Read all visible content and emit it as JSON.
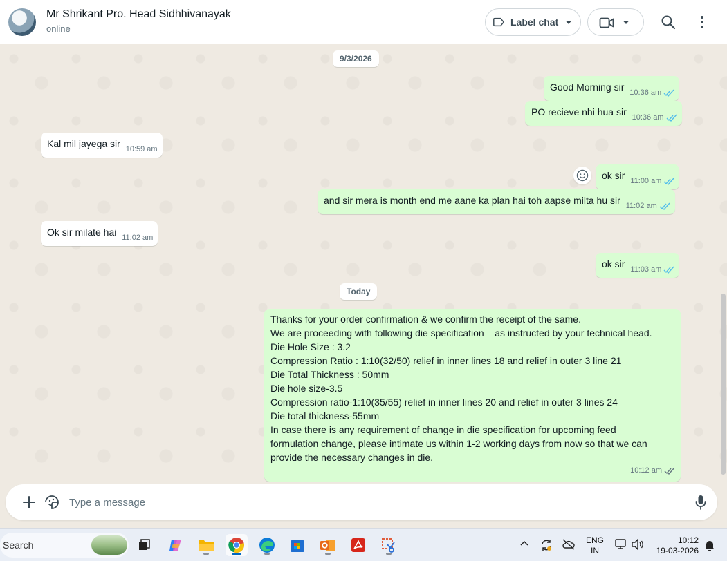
{
  "header": {
    "contact_name": "Mr Shrikant Pro. Head Sidhhivanayak",
    "status": "online",
    "label_chat": "Label chat",
    "icons": [
      "tag-icon",
      "chevron-down-icon",
      "video-call-icon",
      "search-icon",
      "more-vertical-icon"
    ]
  },
  "chat": {
    "date_1": "9/3/2026",
    "date_2": "Today",
    "messages": [
      {
        "dir": "out",
        "text": "Good Morning sir",
        "time": "10:36 am",
        "status": "read"
      },
      {
        "dir": "out",
        "text": "PO recieve nhi hua sir",
        "time": "10:36 am",
        "status": "read"
      },
      {
        "dir": "in",
        "text": "Kal mil jayega sir",
        "time": "10:59 am"
      },
      {
        "dir": "out",
        "text": "ok sir",
        "time": "11:00 am",
        "status": "read"
      },
      {
        "dir": "out",
        "text": "and sir mera is month end me aane ka plan hai toh aapse milta hu sir",
        "time": "11:02 am",
        "status": "read"
      },
      {
        "dir": "in",
        "text": "Ok sir milate hai",
        "time": "11:02 am"
      },
      {
        "dir": "out",
        "text": "ok sir",
        "time": "11:03 am",
        "status": "read"
      },
      {
        "dir": "out",
        "time": "10:12 am",
        "status": "delivered",
        "lines": [
          "Thanks for your order confirmation & we confirm the receipt of the same.",
          "We are proceeding with following die specification –  as instructed by your technical head.",
          "Die Hole Size : 3.2",
          "Compression Ratio : 1:10(32/50) relief in inner lines 18 and relief in outer 3 line 21",
          "Die Total Thickness : 50mm",
          "Die hole size-3.5",
          "Compression ratio-1:10(35/55) relief in inner lines 20 and relief in outer 3 lines 24",
          "Die total thickness-55mm",
          "In case there is any requirement of change in die specification for upcoming feed",
          "formulation change, please intimate us within 1-2 working days from now so that we can",
          "provide the necessary changes in die."
        ]
      }
    ]
  },
  "composer": {
    "placeholder": "Type a message",
    "icons": [
      "plus-icon",
      "sticker-icon",
      "microphone-icon"
    ]
  },
  "taskbar": {
    "search_label": "Search",
    "lang_line1": "ENG",
    "lang_line2": "IN",
    "time": "10:12",
    "date": "19-03-2026",
    "apps": [
      "task-view",
      "copilot",
      "file-explorer",
      "chrome",
      "edge",
      "microsoft-store",
      "outlook",
      "acrobat",
      "snipping-tool"
    ]
  },
  "colors": {
    "outgoing_bubble": "#d9fdd3",
    "incoming_bubble": "#ffffff",
    "chat_background": "#efeae2",
    "read_tick": "#53bdeb",
    "delivered_tick": "#667781"
  }
}
